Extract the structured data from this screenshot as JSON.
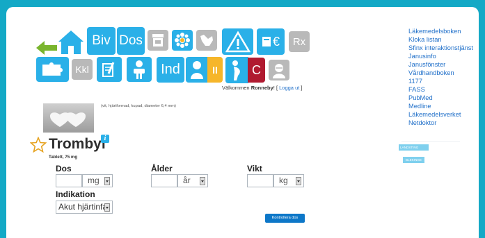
{
  "toolbar": {
    "row1": {
      "back": "back-arrow-icon",
      "home": "home-icon",
      "biv": "Biv",
      "dos": "Dos",
      "storage": "container-icon",
      "allergy": "allergen-icon",
      "animal": "animal-icon",
      "warning": "warning-icon",
      "price": "€",
      "rx": "Rx"
    },
    "row2": {
      "puzzle": "puzzle-icon",
      "kkl": "Kkl",
      "document": "document-edit-icon",
      "person": "person-icon",
      "ind": "Ind",
      "child": "child-icon",
      "pause": "II",
      "pregnancy": "pregnancy-icon",
      "c": "C",
      "elderly": "elderly-icon"
    }
  },
  "welcome": {
    "prefix": "Välkommen ",
    "user": "Ronneby",
    "suffix": "! [ ",
    "logout": "Logga ut",
    "close": " ]"
  },
  "pill": {
    "description": "(vit, hjärtformad, kupad, diameter 6,4 mm)"
  },
  "drug": {
    "name": "Trombyl",
    "info_icon": "info-icon",
    "favorite_icon": "star-icon",
    "form": "Tablett, 75 mg"
  },
  "form": {
    "dos_label": "Dos",
    "dos_value": "",
    "dos_unit": "mg",
    "alder_label": "Ålder",
    "alder_value": "",
    "alder_unit": "år",
    "vikt_label": "Vikt",
    "vikt_value": "",
    "vikt_unit": "kg",
    "indikation_label": "Indikation",
    "indikation_value": "Akut hjärtinfa",
    "submit": "Kontrollera dos"
  },
  "sidebar": {
    "links": [
      "Läkemedelsboken",
      "Kloka listan",
      "Sfinx interaktionstjänst",
      "Janusinfo",
      "Janusfönster",
      "Vårdhandboken",
      "1177",
      "FASS",
      "PubMed",
      "Medline",
      "Läkemedelsverket",
      "Netdoktor"
    ],
    "badge1": "LANDSTING",
    "badge2": "BLEKINGE"
  },
  "colors": {
    "background": "#14a9c6",
    "icon_blue": "#2ab0e8",
    "icon_grey": "#b9b9b9",
    "icon_green": "#7ab52e",
    "pause_yellow": "#f6b62a",
    "c_red": "#b01a30",
    "link": "#1f6fc9",
    "button": "#0d77c8"
  }
}
